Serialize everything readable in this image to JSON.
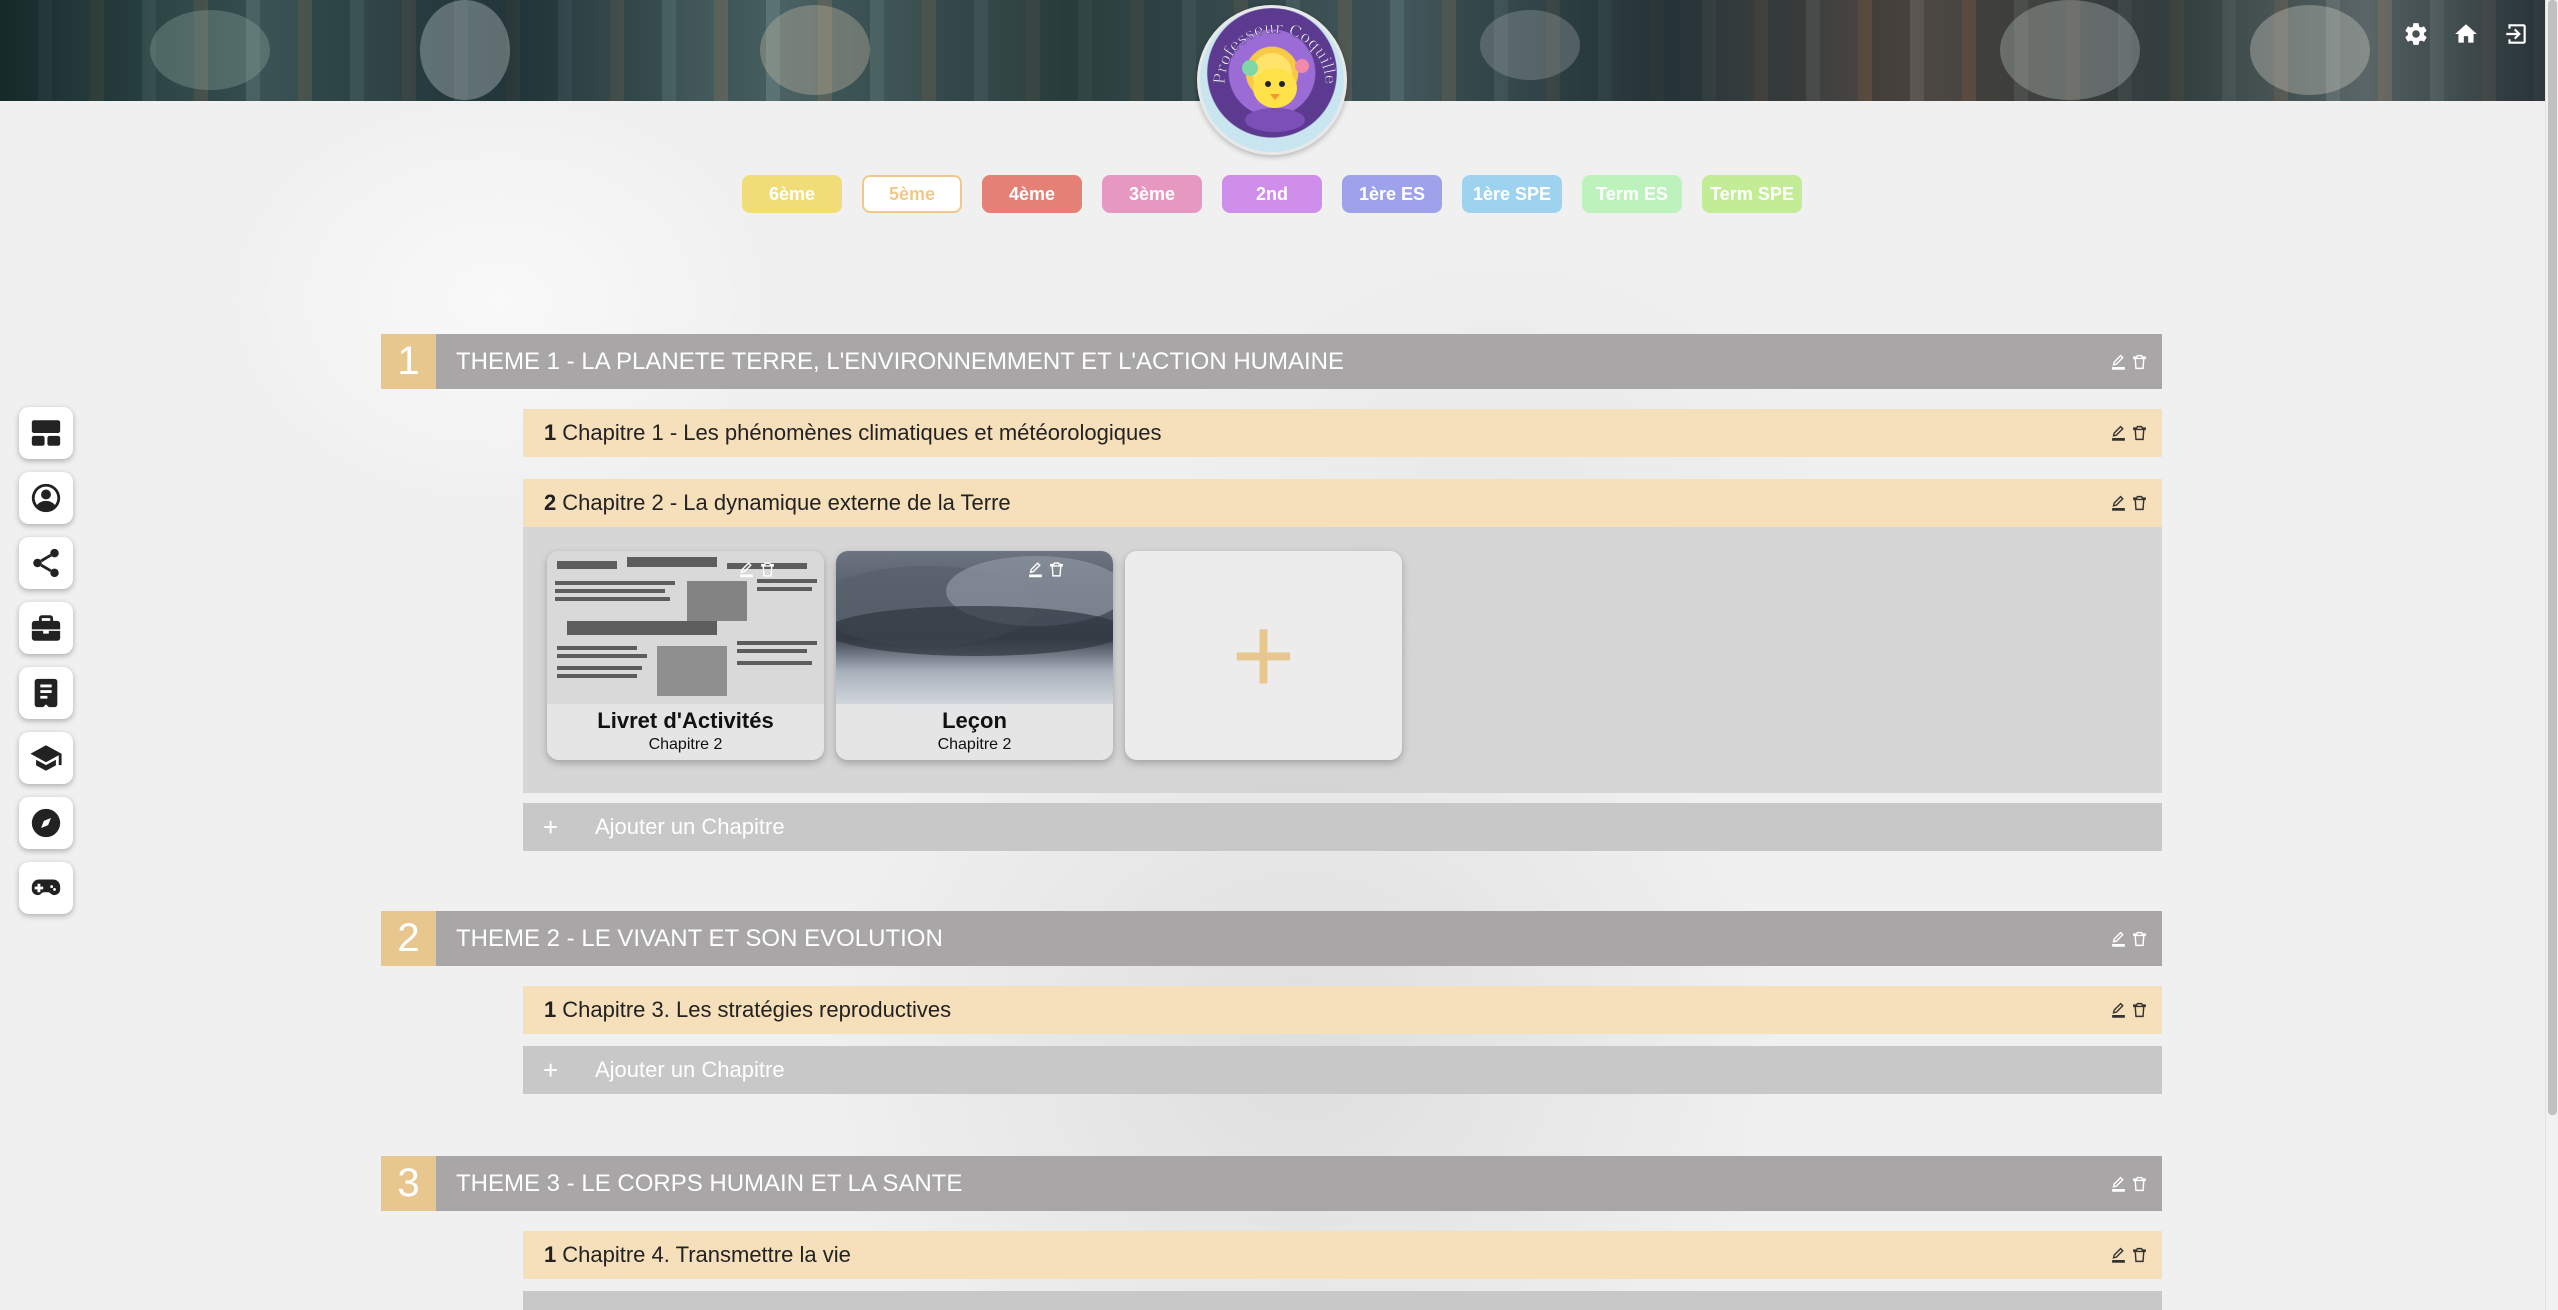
{
  "header": {
    "icons": [
      "gear-icon",
      "home-icon",
      "logout-icon"
    ]
  },
  "logo": {
    "text": "Professeur Coquille"
  },
  "levels": [
    {
      "label": "6ème",
      "bg": "#f0dd77",
      "border": "#f0dd77",
      "color": "#ffffff"
    },
    {
      "label": "5ème",
      "bg": "#ffffff",
      "border": "#f0c98a",
      "color": "#f0c98a"
    },
    {
      "label": "4ème",
      "bg": "#e58076",
      "border": "#e58076",
      "color": "#ffffff"
    },
    {
      "label": "3ème",
      "bg": "#e798c0",
      "border": "#e798c0",
      "color": "#ffffff"
    },
    {
      "label": "2nd",
      "bg": "#cf8ee9",
      "border": "#cf8ee9",
      "color": "#ffffff"
    },
    {
      "label": "1ère ES",
      "bg": "#9ea2ea",
      "border": "#9ea2ea",
      "color": "#ffffff"
    },
    {
      "label": "1ère SPE",
      "bg": "#9ed3f0",
      "border": "#9ed3f0",
      "color": "#ffffff"
    },
    {
      "label": "Term ES",
      "bg": "#bdf2bd",
      "border": "#bdf2bd",
      "color": "#ffffff"
    },
    {
      "label": "Term SPE",
      "bg": "#c3ec97",
      "border": "#c3ec97",
      "color": "#ffffff"
    }
  ],
  "sidebar": {
    "items": [
      "dashboard-icon",
      "user-circle-icon",
      "share-icon",
      "briefcase-icon",
      "document-icon",
      "graduation-cap-icon",
      "compass-icon",
      "gamepad-icon"
    ]
  },
  "themes": [
    {
      "num": "1",
      "title": "THEME 1 - LA PLANETE TERRE, L'ENVIRONNEMMENT ET L'ACTION HUMAINE",
      "chapters": [
        {
          "num": "1",
          "title": "Chapitre 1 - Les phénomènes climatiques et météorologiques"
        },
        {
          "num": "2",
          "title": "Chapitre 2 - La dynamique externe de la Terre"
        }
      ],
      "cards": [
        {
          "title": "Livret d'Activités",
          "sub": "Chapitre 2"
        },
        {
          "title": "Leçon",
          "sub": "Chapitre 2"
        }
      ],
      "add_card": "+",
      "add_chapter": {
        "plus": "+",
        "label": "Ajouter un Chapitre"
      }
    },
    {
      "num": "2",
      "title": "THEME 2 - LE VIVANT ET SON EVOLUTION",
      "chapters": [
        {
          "num": "1",
          "title": "Chapitre 3. Les stratégies reproductives"
        }
      ],
      "add_chapter": {
        "plus": "+",
        "label": "Ajouter un Chapitre"
      }
    },
    {
      "num": "3",
      "title": "THEME 3 - LE CORPS HUMAIN ET LA SANTE",
      "chapters": [
        {
          "num": "1",
          "title": "Chapitre 4. Transmettre la vie"
        }
      ]
    }
  ]
}
